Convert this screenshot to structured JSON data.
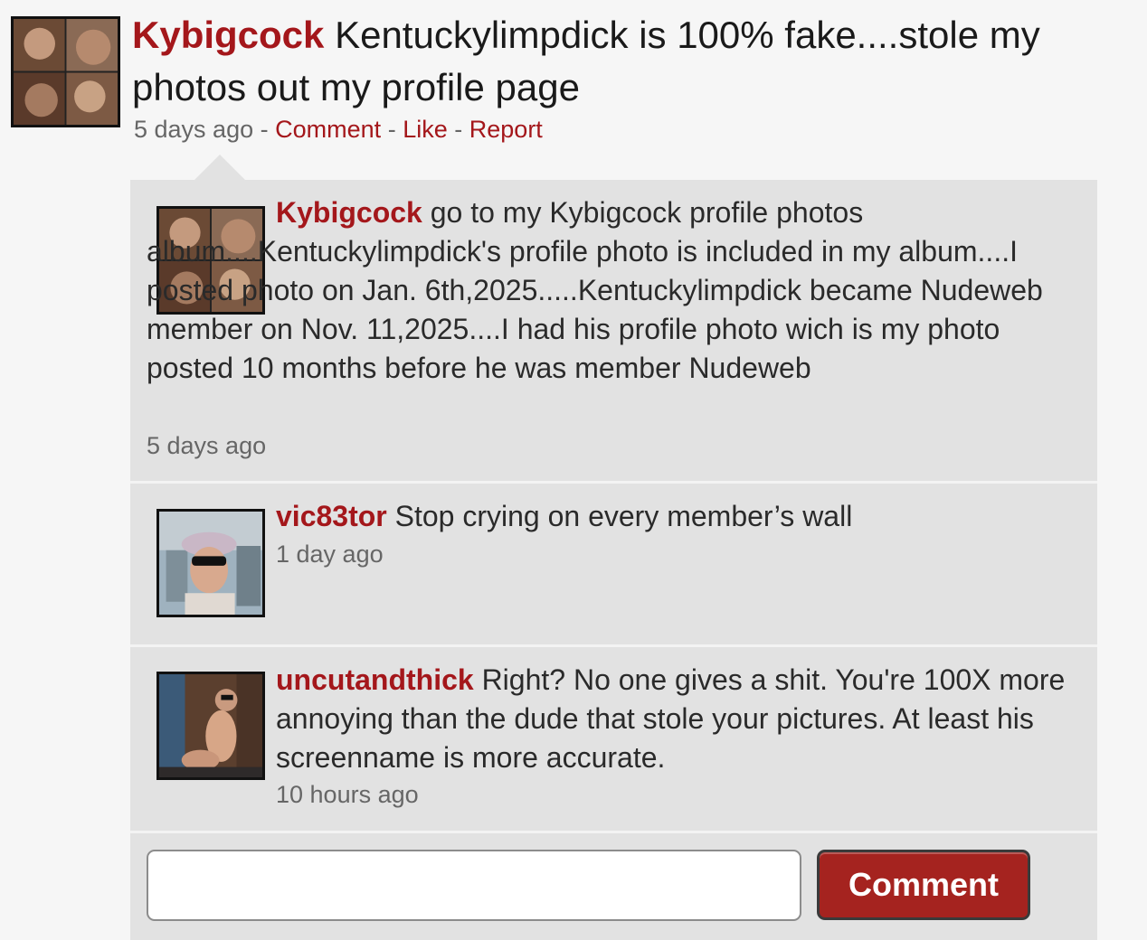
{
  "post": {
    "author": "Kybigcock",
    "text": "Kentuckylimpdick is 100% fake....stole my photos out my profile page",
    "time": "5 days ago",
    "sep": "-",
    "actions": {
      "comment": "Comment",
      "like": "Like",
      "report": "Report"
    }
  },
  "comments": [
    {
      "author": "Kybigcock",
      "text": "go to my Kybigcock profile photos album....Kentuckylimpdick's profile photo is included in my album....I posted photo on Jan. 6th,2025.....Kentuckylimpdick became Nudeweb member on Nov. 11,2025....I had his profile photo wich is my photo posted 10 months before he was member Nudeweb",
      "time": "5 days ago"
    },
    {
      "author": "vic83tor",
      "text": "Stop crying on every member’s wall",
      "time": "1 day ago"
    },
    {
      "author": "uncutandthick",
      "text": "Right? No one gives a shit. You're 100X more annoying than the dude that stole your pictures. At least his screenname is more accurate.",
      "time": "10 hours ago"
    }
  ],
  "reply_form": {
    "input_value": "",
    "button_label": "Comment"
  },
  "colors": {
    "username": "#a4171b",
    "button": "#a5231f",
    "thread_bg": "#e2e2e2",
    "page_bg": "#f6f6f6"
  }
}
